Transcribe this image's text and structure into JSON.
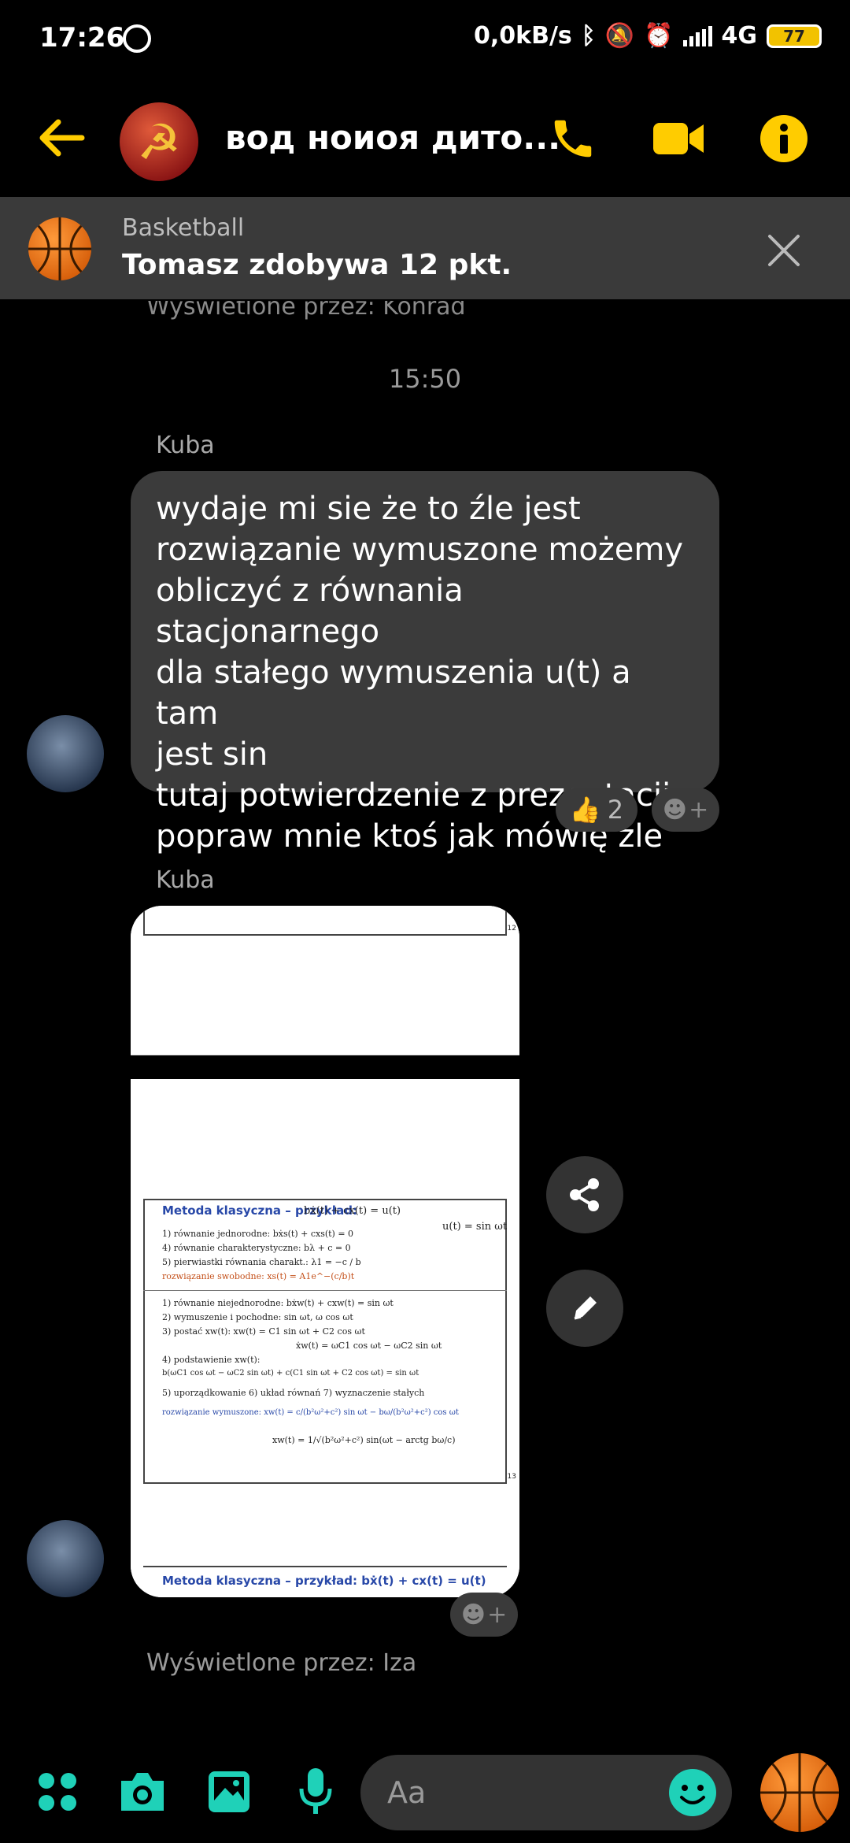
{
  "status_bar": {
    "time": "17:26",
    "net_speed": "0,0kB/s",
    "network": "4G",
    "battery": "77"
  },
  "header": {
    "title": "вод ноиоя дито..."
  },
  "notification": {
    "title": "Basketball",
    "text": "Tomasz zdobywa 12 pkt."
  },
  "chat": {
    "seen_top": "Wyświetlone przez: Konrad",
    "timestamp": "15:50",
    "messages": [
      {
        "sender": "Kuba",
        "lines": [
          "wydaje mi sie że to źle jest",
          "rozwiązanie wymuszone możemy",
          "obliczyć z równania stacjonarnego",
          "dla stałego wymuszenia u(t) a tam",
          "jest sin",
          "tutaj potwierdzenie z prezentacji",
          "popraw mnie ktoś jak mówię źle"
        ],
        "reaction_count": "2"
      },
      {
        "sender": "Kuba",
        "image": {
          "slide_top_num": "12",
          "title": "Metoda klasyczna – przykład:",
          "equation": "bẋ(t) + cx(t) = u(t)",
          "input": "u(t) = sin ωt",
          "lines": [
            "1) równanie jednorodne:      bẋs(t) + cxs(t) = 0",
            "4) równanie charakterystyczne:  bλ + c = 0",
            "5) pierwiastki równania charakt.:  λ1 = −c / b",
            "rozwiązanie swobodne:      xs(t) = A1e^−(c/b)t",
            "1) równanie niejednorodne:    bẋw(t) + cxw(t) = sin ωt",
            "2) wymuszenie i pochodne:    sin ωt, ω cos ωt",
            "3) postać xw(t):   xw(t) = C1 sin ωt + C2 cos ωt",
            "ẋw(t) = ωC1 cos ωt − ωC2 sin ωt",
            "4) podstawienie xw(t):",
            "b(ωC1 cos ωt − ωC2 sin ωt) + c(C1 sin ωt + C2 cos ωt) = sin ωt",
            "5) uporządkowanie    6) układ równań    7) wyznaczenie stałych",
            "rozwiązanie wymuszone:  xw(t) = c/(b²ω²+c²) sin ωt − bω/(b²ω²+c²) cos ωt",
            "xw(t) = 1/√(b²ω²+c²) sin(ωt − arctg bω/c)"
          ],
          "slide_num": "13",
          "bottom_title": "Metoda klasyczna – przykład:  bẋ(t) + cx(t) = u(t)"
        }
      }
    ],
    "seen_bottom": "Wyświetlone przez: Iza"
  },
  "composer": {
    "placeholder": "Aa"
  },
  "colors": {
    "accent": "#ffcc00",
    "teal": "#1fd1b8",
    "bubble": "#3b3b3b",
    "banner": "#3a3a3a"
  },
  "icons": [
    "back-arrow-icon",
    "phone-icon",
    "video-camera-icon",
    "info-icon",
    "close-icon",
    "share-icon",
    "pencil-icon",
    "apps-icon",
    "camera-icon",
    "gallery-icon",
    "microphone-icon",
    "emoji-icon",
    "basketball-icon",
    "thumbs-up-icon"
  ]
}
